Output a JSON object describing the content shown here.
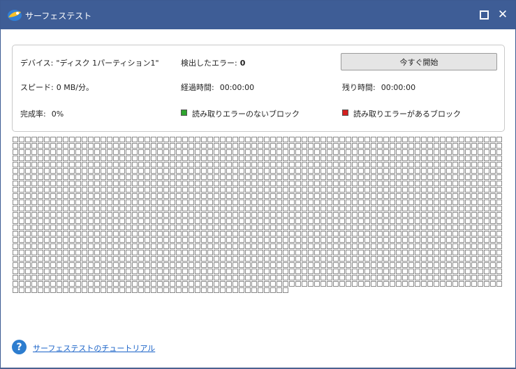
{
  "window": {
    "title": "サーフェステスト"
  },
  "info": {
    "device_label": "デバイス:",
    "device_value": "\"ディスク 1パーティション1\"",
    "errors_label": "検出したエラー:",
    "errors_value": "0",
    "start_button": "今すぐ開始",
    "speed_label": "スピード:",
    "speed_value": "0 MB/分。",
    "elapsed_label": "経過時間:",
    "elapsed_value": "00:00:00",
    "remaining_label": "残り時間:",
    "remaining_value": "00:00:00",
    "progress_label": "完成率:",
    "progress_value": "0%",
    "legend_ok": "読み取りエラーのないブロック",
    "legend_error": "読み取りエラーがあるブロック"
  },
  "colors": {
    "title_bar": "#3e5d96",
    "legend_ok": "#2ea52e",
    "legend_error": "#d42020",
    "block_border": "#8a8a8a",
    "link": "#1a63c8"
  },
  "blocks": {
    "total": 1916,
    "columns": 78,
    "status": "pending"
  },
  "footer": {
    "help_icon": "question-circle-icon",
    "tutorial_link": "サーフェステストのチュートリアル"
  }
}
